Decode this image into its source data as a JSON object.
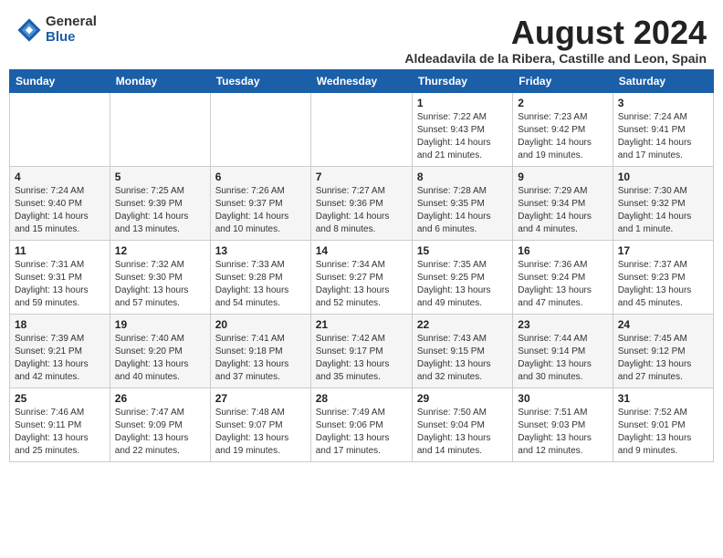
{
  "logo": {
    "general": "General",
    "blue": "Blue"
  },
  "title": "August 2024",
  "subtitle": "Aldeadavila de la Ribera, Castille and Leon, Spain",
  "days_of_week": [
    "Sunday",
    "Monday",
    "Tuesday",
    "Wednesday",
    "Thursday",
    "Friday",
    "Saturday"
  ],
  "weeks": [
    [
      {
        "day": "",
        "info": ""
      },
      {
        "day": "",
        "info": ""
      },
      {
        "day": "",
        "info": ""
      },
      {
        "day": "",
        "info": ""
      },
      {
        "day": "1",
        "info": "Sunrise: 7:22 AM\nSunset: 9:43 PM\nDaylight: 14 hours\nand 21 minutes."
      },
      {
        "day": "2",
        "info": "Sunrise: 7:23 AM\nSunset: 9:42 PM\nDaylight: 14 hours\nand 19 minutes."
      },
      {
        "day": "3",
        "info": "Sunrise: 7:24 AM\nSunset: 9:41 PM\nDaylight: 14 hours\nand 17 minutes."
      }
    ],
    [
      {
        "day": "4",
        "info": "Sunrise: 7:24 AM\nSunset: 9:40 PM\nDaylight: 14 hours\nand 15 minutes."
      },
      {
        "day": "5",
        "info": "Sunrise: 7:25 AM\nSunset: 9:39 PM\nDaylight: 14 hours\nand 13 minutes."
      },
      {
        "day": "6",
        "info": "Sunrise: 7:26 AM\nSunset: 9:37 PM\nDaylight: 14 hours\nand 10 minutes."
      },
      {
        "day": "7",
        "info": "Sunrise: 7:27 AM\nSunset: 9:36 PM\nDaylight: 14 hours\nand 8 minutes."
      },
      {
        "day": "8",
        "info": "Sunrise: 7:28 AM\nSunset: 9:35 PM\nDaylight: 14 hours\nand 6 minutes."
      },
      {
        "day": "9",
        "info": "Sunrise: 7:29 AM\nSunset: 9:34 PM\nDaylight: 14 hours\nand 4 minutes."
      },
      {
        "day": "10",
        "info": "Sunrise: 7:30 AM\nSunset: 9:32 PM\nDaylight: 14 hours\nand 1 minute."
      }
    ],
    [
      {
        "day": "11",
        "info": "Sunrise: 7:31 AM\nSunset: 9:31 PM\nDaylight: 13 hours\nand 59 minutes."
      },
      {
        "day": "12",
        "info": "Sunrise: 7:32 AM\nSunset: 9:30 PM\nDaylight: 13 hours\nand 57 minutes."
      },
      {
        "day": "13",
        "info": "Sunrise: 7:33 AM\nSunset: 9:28 PM\nDaylight: 13 hours\nand 54 minutes."
      },
      {
        "day": "14",
        "info": "Sunrise: 7:34 AM\nSunset: 9:27 PM\nDaylight: 13 hours\nand 52 minutes."
      },
      {
        "day": "15",
        "info": "Sunrise: 7:35 AM\nSunset: 9:25 PM\nDaylight: 13 hours\nand 49 minutes."
      },
      {
        "day": "16",
        "info": "Sunrise: 7:36 AM\nSunset: 9:24 PM\nDaylight: 13 hours\nand 47 minutes."
      },
      {
        "day": "17",
        "info": "Sunrise: 7:37 AM\nSunset: 9:23 PM\nDaylight: 13 hours\nand 45 minutes."
      }
    ],
    [
      {
        "day": "18",
        "info": "Sunrise: 7:39 AM\nSunset: 9:21 PM\nDaylight: 13 hours\nand 42 minutes."
      },
      {
        "day": "19",
        "info": "Sunrise: 7:40 AM\nSunset: 9:20 PM\nDaylight: 13 hours\nand 40 minutes."
      },
      {
        "day": "20",
        "info": "Sunrise: 7:41 AM\nSunset: 9:18 PM\nDaylight: 13 hours\nand 37 minutes."
      },
      {
        "day": "21",
        "info": "Sunrise: 7:42 AM\nSunset: 9:17 PM\nDaylight: 13 hours\nand 35 minutes."
      },
      {
        "day": "22",
        "info": "Sunrise: 7:43 AM\nSunset: 9:15 PM\nDaylight: 13 hours\nand 32 minutes."
      },
      {
        "day": "23",
        "info": "Sunrise: 7:44 AM\nSunset: 9:14 PM\nDaylight: 13 hours\nand 30 minutes."
      },
      {
        "day": "24",
        "info": "Sunrise: 7:45 AM\nSunset: 9:12 PM\nDaylight: 13 hours\nand 27 minutes."
      }
    ],
    [
      {
        "day": "25",
        "info": "Sunrise: 7:46 AM\nSunset: 9:11 PM\nDaylight: 13 hours\nand 25 minutes."
      },
      {
        "day": "26",
        "info": "Sunrise: 7:47 AM\nSunset: 9:09 PM\nDaylight: 13 hours\nand 22 minutes."
      },
      {
        "day": "27",
        "info": "Sunrise: 7:48 AM\nSunset: 9:07 PM\nDaylight: 13 hours\nand 19 minutes."
      },
      {
        "day": "28",
        "info": "Sunrise: 7:49 AM\nSunset: 9:06 PM\nDaylight: 13 hours\nand 17 minutes."
      },
      {
        "day": "29",
        "info": "Sunrise: 7:50 AM\nSunset: 9:04 PM\nDaylight: 13 hours\nand 14 minutes."
      },
      {
        "day": "30",
        "info": "Sunrise: 7:51 AM\nSunset: 9:03 PM\nDaylight: 13 hours\nand 12 minutes."
      },
      {
        "day": "31",
        "info": "Sunrise: 7:52 AM\nSunset: 9:01 PM\nDaylight: 13 hours\nand 9 minutes."
      }
    ]
  ]
}
